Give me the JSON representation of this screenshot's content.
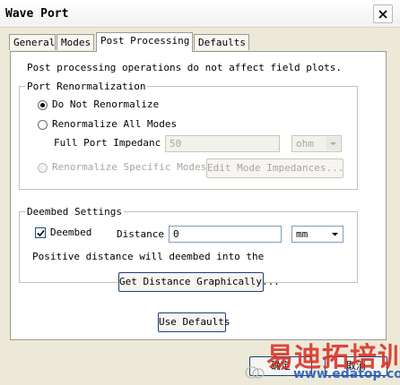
{
  "window": {
    "title": "Wave Port"
  },
  "tabs": [
    {
      "label": "General"
    },
    {
      "label": "Modes"
    },
    {
      "label": "Post Processing",
      "active": true
    },
    {
      "label": "Defaults"
    }
  ],
  "info_text": "Post processing operations do not affect field plots.",
  "renorm": {
    "legend": "Port Renormalization",
    "opt_none": "Do Not Renormalize",
    "opt_all": "Renormalize All Modes",
    "impedance_label": "Full Port Impedanc",
    "impedance_value": "50",
    "impedance_unit": "ohm",
    "opt_specific": "Renormalize Specific Modes",
    "edit_button": "Edit Mode Impedances...",
    "selected": "opt_none"
  },
  "deembed": {
    "legend": "Deembed Settings",
    "checkbox_label": "Deembed",
    "checked": true,
    "distance_label": "Distance",
    "distance_value": "0",
    "distance_unit": "mm",
    "hint": "Positive distance will deembed into the",
    "get_distance_button": "Get Distance Graphically..."
  },
  "use_defaults_button": "Use Defaults",
  "footer": {
    "ok": "确定",
    "cancel": "取消"
  },
  "watermark": {
    "text": "易迪拓培训",
    "url": "www.edatop.com"
  },
  "colors": {
    "accent": "#1f3f7a",
    "watermark_red": "#d93025"
  }
}
